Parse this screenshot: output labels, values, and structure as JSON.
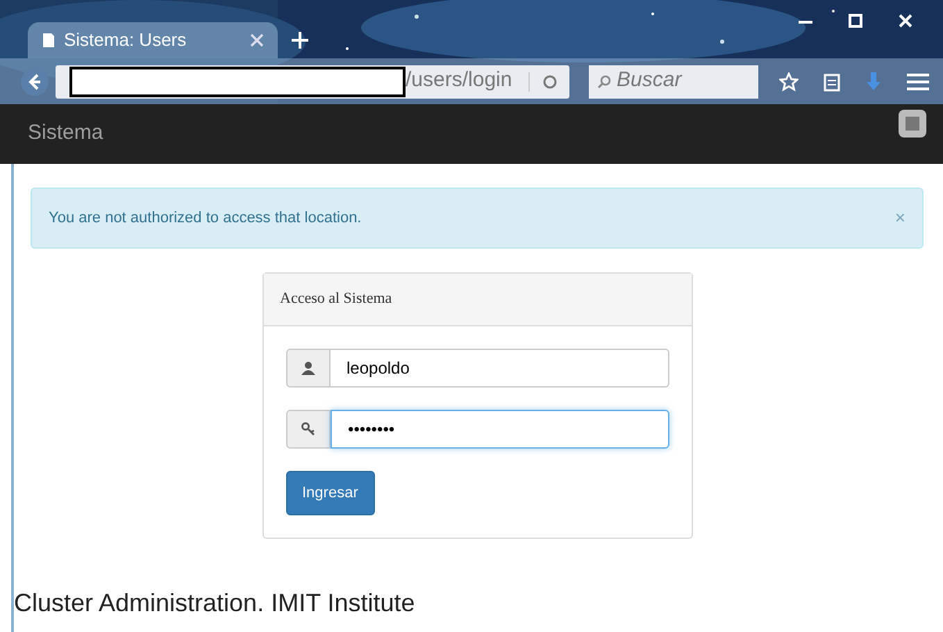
{
  "window": {
    "tab_title": "Sistema: Users",
    "address": "/users/login",
    "search_placeholder": "Buscar"
  },
  "navbar": {
    "brand": "Sistema"
  },
  "alert": {
    "message": "You are not authorized to access that location.",
    "close": "×"
  },
  "login_card": {
    "title": "Acceso al Sistema",
    "fields": [
      {
        "kind": "user",
        "value": "leopoldo",
        "focused": false
      },
      {
        "kind": "key",
        "value": "••••••••",
        "focused": true
      }
    ],
    "button": "Ingresar"
  },
  "footer": "Cluster Administration. IMIT Institute"
}
